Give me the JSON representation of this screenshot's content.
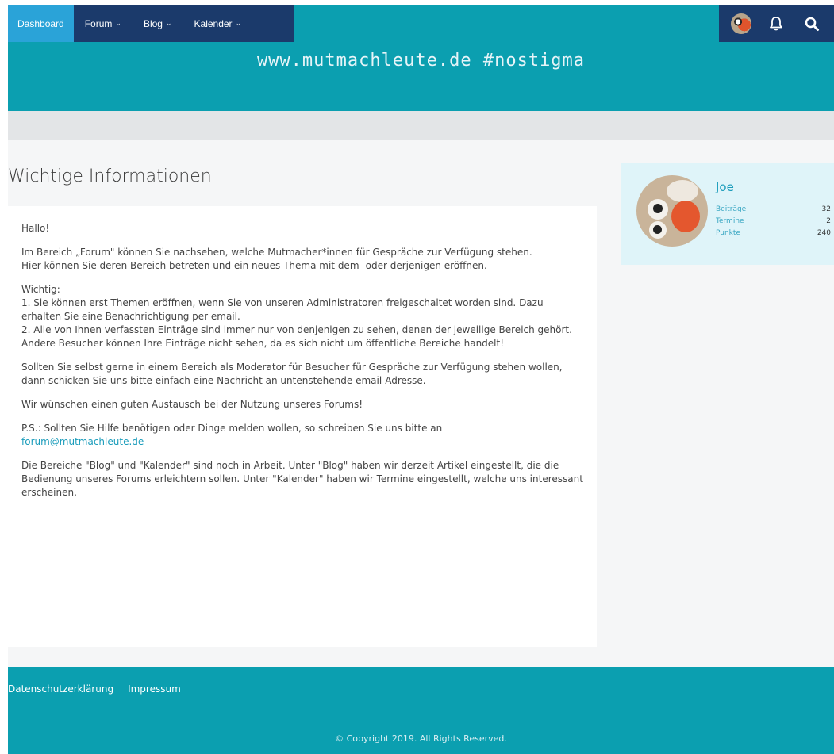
{
  "nav": {
    "items": [
      {
        "label": "Dashboard",
        "caret": ""
      },
      {
        "label": "Forum",
        "caret": "⌄"
      },
      {
        "label": "Blog",
        "caret": "⌄"
      },
      {
        "label": "Kalender",
        "caret": "⌄"
      }
    ],
    "right_icons": [
      "user-avatar",
      "bell-icon",
      "search-icon"
    ]
  },
  "header": {
    "site_title": "www.mutmachleute.de #nostigma"
  },
  "main": {
    "page_title": "Wichtige Informationen",
    "paragraphs": [
      "Hallo!",
      "Im Bereich „Forum\" können Sie nachsehen, welche Mutmacher*innen für Gespräche zur Verfügung stehen.\nHier können Sie deren Bereich betreten und ein neues Thema mit dem- oder derjenigen eröffnen.",
      "Wichtig:\n1. Sie können erst Themen eröffnen, wenn Sie von unseren Administratoren freigeschaltet worden sind. Dazu erhalten Sie eine Benachrichtigung per email.\n2. Alle von Ihnen verfassten Einträge sind immer nur von denjenigen zu sehen, denen der jeweilige Bereich gehört.\nAndere Besucher können Ihre Einträge nicht sehen, da es sich nicht um öffentliche Bereiche handelt!",
      "Sollten Sie selbst gerne in einem Bereich als Moderator für Besucher für Gespräche zur Verfügung stehen wollen, dann schicken Sie uns bitte einfach eine Nachricht an untenstehende email-Adresse.",
      "Wir wünschen einen guten Austausch bei der Nutzung unseres Forums!"
    ],
    "ps_text": "P.S.: Sollten Sie Hilfe benötigen oder Dinge melden wollen, so schreiben Sie uns bitte an",
    "ps_email": "forum@mutmachleute.de",
    "closing": "Die Bereiche \"Blog\" und \"Kalender\" sind noch in Arbeit. Unter \"Blog\" haben wir derzeit Artikel eingestellt, die die Bedienung unseres Forums erleichtern sollen. Unter \"Kalender\" haben wir Termine eingestellt, welche uns interessant erscheinen."
  },
  "sidebar": {
    "username": "Joe",
    "stats": [
      {
        "label": "Beiträge",
        "value": "32"
      },
      {
        "label": "Termine",
        "value": "2"
      },
      {
        "label": "Punkte",
        "value": "240"
      }
    ]
  },
  "footer": {
    "links": [
      "Datenschutzerklärung",
      "Impressum"
    ],
    "copyright": "© Copyright 2019. All Rights Reserved."
  },
  "colors": {
    "header_bg": "#0b9fb0",
    "nav_bg": "#1b3a6b",
    "nav_active": "#2aa3d8",
    "link": "#1a9cbb"
  }
}
